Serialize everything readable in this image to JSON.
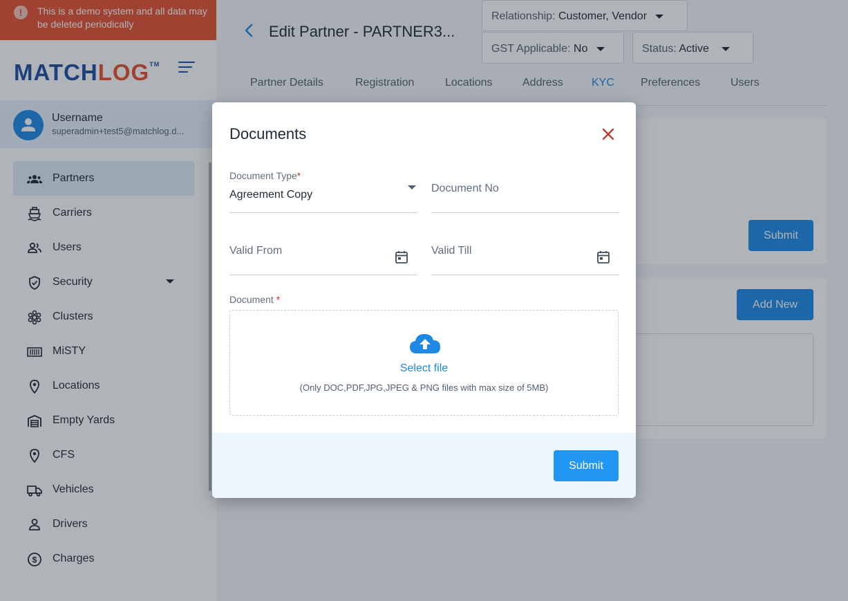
{
  "demo_banner": {
    "text": "This is a demo system and all data may be deleted periodically"
  },
  "brand": {
    "logo_part1": "MATCH",
    "logo_part2": "LOG",
    "trademark": "TM"
  },
  "user": {
    "name": "Username",
    "email": "superadmin+test5@matchlog.d..."
  },
  "sidebar": {
    "items": [
      {
        "label": "Partners",
        "icon": "partners-icon"
      },
      {
        "label": "Carriers",
        "icon": "ship-icon"
      },
      {
        "label": "Users",
        "icon": "users-icon"
      },
      {
        "label": "Security",
        "icon": "shield-icon"
      },
      {
        "label": "Clusters",
        "icon": "clusters-icon"
      },
      {
        "label": "MiSTY",
        "icon": "container-icon"
      },
      {
        "label": "Locations",
        "icon": "location-pin-icon"
      },
      {
        "label": "Empty Yards",
        "icon": "warehouse-icon"
      },
      {
        "label": "CFS",
        "icon": "location-pin-icon"
      },
      {
        "label": "Vehicles",
        "icon": "truck-icon"
      },
      {
        "label": "Drivers",
        "icon": "person-icon"
      },
      {
        "label": "Charges",
        "icon": "dollar-icon"
      }
    ]
  },
  "header": {
    "title": "Edit Partner - PARTNER3...",
    "relationship": {
      "label": "Relationship:",
      "value": "Customer, Vendor"
    },
    "gst": {
      "label": "GST Applicable:",
      "value": "No"
    },
    "status": {
      "label": "Status:",
      "value": "Active"
    }
  },
  "tabs": [
    {
      "label": "Partner Details"
    },
    {
      "label": "Registration"
    },
    {
      "label": "Locations"
    },
    {
      "label": "Address"
    },
    {
      "label": "KYC"
    },
    {
      "label": "Preferences"
    },
    {
      "label": "Users"
    }
  ],
  "background_buttons": {
    "submit": "Submit",
    "add_new": "Add New"
  },
  "modal": {
    "title": "Documents",
    "document_type": {
      "label": "Document Type",
      "required": "*",
      "value": "Agreement Copy"
    },
    "document_no": {
      "placeholder": "Document No"
    },
    "valid_from": {
      "placeholder": "Valid From"
    },
    "valid_till": {
      "placeholder": "Valid Till"
    },
    "document": {
      "label": "Document",
      "required": "*",
      "select_file": "Select file",
      "hint": "(Only DOC,PDF,JPG,JPEG & PNG files with max size of 5MB)"
    },
    "submit": "Submit"
  },
  "colors": {
    "brand_blue": "#1c4e9e",
    "brand_orange": "#e5502e",
    "accent": "#1e88e5",
    "required": "#c0392b",
    "close": "#c0392b"
  }
}
